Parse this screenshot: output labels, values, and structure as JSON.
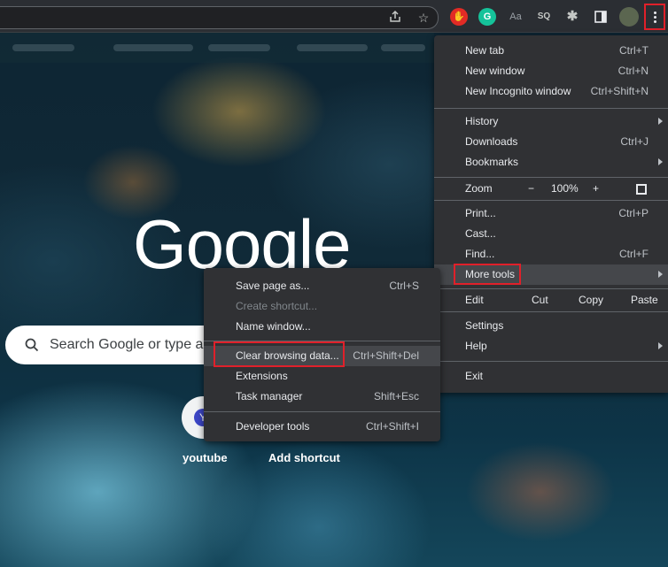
{
  "search": {
    "placeholder": "Search Google or type a"
  },
  "google_logo": "Google",
  "shortcuts": [
    {
      "label": "youtube",
      "initial": "Y"
    },
    {
      "label": "Add shortcut"
    }
  ],
  "extensions": [
    {
      "name": "adblock-icon",
      "color": "#e22b25"
    },
    {
      "name": "grammarly-icon",
      "color": "#15c39a",
      "glyph": "G"
    },
    {
      "name": "font-icon",
      "glyph": "Aa"
    },
    {
      "name": "sq-icon",
      "glyph": "SQ"
    }
  ],
  "main_menu": {
    "new_tab": {
      "label": "New tab",
      "shortcut": "Ctrl+T"
    },
    "new_window": {
      "label": "New window",
      "shortcut": "Ctrl+N"
    },
    "new_incognito": {
      "label": "New Incognito window",
      "shortcut": "Ctrl+Shift+N"
    },
    "history": {
      "label": "History"
    },
    "downloads": {
      "label": "Downloads",
      "shortcut": "Ctrl+J"
    },
    "bookmarks": {
      "label": "Bookmarks"
    },
    "zoom": {
      "label": "Zoom",
      "minus": "−",
      "value": "100%",
      "plus": "+"
    },
    "print": {
      "label": "Print...",
      "shortcut": "Ctrl+P"
    },
    "cast": {
      "label": "Cast..."
    },
    "find": {
      "label": "Find...",
      "shortcut": "Ctrl+F"
    },
    "more_tools": {
      "label": "More tools"
    },
    "edit": {
      "label": "Edit",
      "cut": "Cut",
      "copy": "Copy",
      "paste": "Paste"
    },
    "settings": {
      "label": "Settings"
    },
    "help": {
      "label": "Help"
    },
    "exit": {
      "label": "Exit"
    }
  },
  "more_tools_menu": {
    "save_page": {
      "label": "Save page as...",
      "shortcut": "Ctrl+S"
    },
    "create_shortcut": {
      "label": "Create shortcut..."
    },
    "name_window": {
      "label": "Name window..."
    },
    "clear_browsing": {
      "label": "Clear browsing data...",
      "shortcut": "Ctrl+Shift+Del"
    },
    "extensions": {
      "label": "Extensions"
    },
    "task_manager": {
      "label": "Task manager",
      "shortcut": "Shift+Esc"
    },
    "developer_tools": {
      "label": "Developer tools",
      "shortcut": "Ctrl+Shift+I"
    }
  }
}
